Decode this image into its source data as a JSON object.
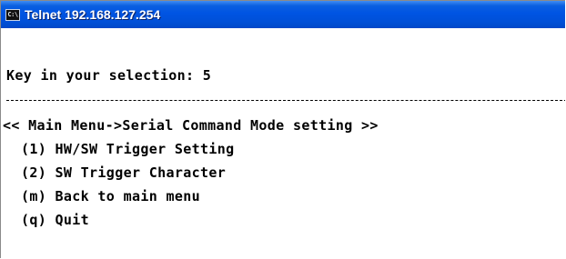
{
  "window": {
    "title": "Telnet 192.168.127.254",
    "icon": "console-icon",
    "icon_text": "C:\\"
  },
  "console": {
    "prompt": "Key in your selection: 5",
    "menu_header": "<< Main Menu->Serial Command Mode setting >>",
    "options": [
      "(1) HW/SW Trigger Setting",
      "(2) SW Trigger Character",
      "(m) Back to main menu",
      "(q) Quit"
    ]
  },
  "colors": {
    "titlebar": "#0054e3",
    "console_bg": "#ffffff",
    "console_text": "#000000"
  }
}
